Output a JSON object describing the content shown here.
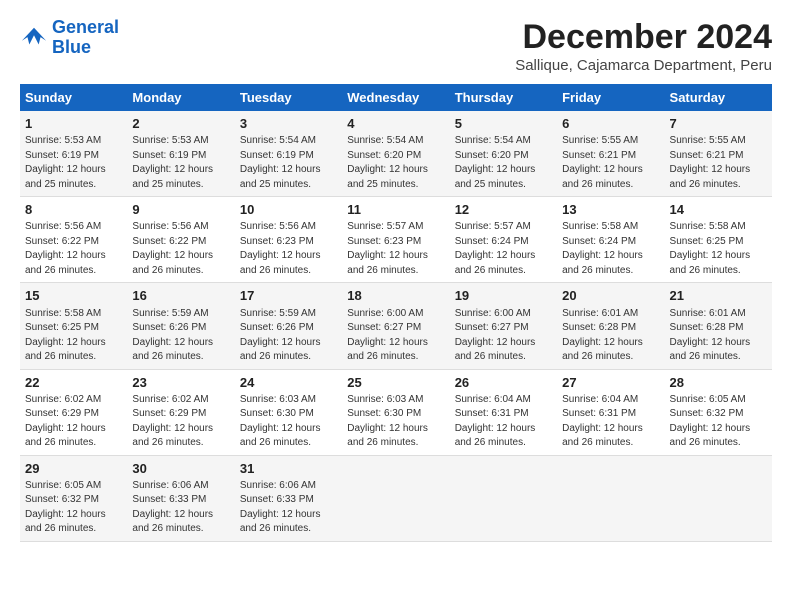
{
  "logo": {
    "line1": "General",
    "line2": "Blue"
  },
  "title": "December 2024",
  "subtitle": "Sallique, Cajamarca Department, Peru",
  "days_header": [
    "Sunday",
    "Monday",
    "Tuesday",
    "Wednesday",
    "Thursday",
    "Friday",
    "Saturday"
  ],
  "weeks": [
    [
      {
        "day": "1",
        "info": "Sunrise: 5:53 AM\nSunset: 6:19 PM\nDaylight: 12 hours\nand 25 minutes."
      },
      {
        "day": "2",
        "info": "Sunrise: 5:53 AM\nSunset: 6:19 PM\nDaylight: 12 hours\nand 25 minutes."
      },
      {
        "day": "3",
        "info": "Sunrise: 5:54 AM\nSunset: 6:19 PM\nDaylight: 12 hours\nand 25 minutes."
      },
      {
        "day": "4",
        "info": "Sunrise: 5:54 AM\nSunset: 6:20 PM\nDaylight: 12 hours\nand 25 minutes."
      },
      {
        "day": "5",
        "info": "Sunrise: 5:54 AM\nSunset: 6:20 PM\nDaylight: 12 hours\nand 25 minutes."
      },
      {
        "day": "6",
        "info": "Sunrise: 5:55 AM\nSunset: 6:21 PM\nDaylight: 12 hours\nand 26 minutes."
      },
      {
        "day": "7",
        "info": "Sunrise: 5:55 AM\nSunset: 6:21 PM\nDaylight: 12 hours\nand 26 minutes."
      }
    ],
    [
      {
        "day": "8",
        "info": "Sunrise: 5:56 AM\nSunset: 6:22 PM\nDaylight: 12 hours\nand 26 minutes."
      },
      {
        "day": "9",
        "info": "Sunrise: 5:56 AM\nSunset: 6:22 PM\nDaylight: 12 hours\nand 26 minutes."
      },
      {
        "day": "10",
        "info": "Sunrise: 5:56 AM\nSunset: 6:23 PM\nDaylight: 12 hours\nand 26 minutes."
      },
      {
        "day": "11",
        "info": "Sunrise: 5:57 AM\nSunset: 6:23 PM\nDaylight: 12 hours\nand 26 minutes."
      },
      {
        "day": "12",
        "info": "Sunrise: 5:57 AM\nSunset: 6:24 PM\nDaylight: 12 hours\nand 26 minutes."
      },
      {
        "day": "13",
        "info": "Sunrise: 5:58 AM\nSunset: 6:24 PM\nDaylight: 12 hours\nand 26 minutes."
      },
      {
        "day": "14",
        "info": "Sunrise: 5:58 AM\nSunset: 6:25 PM\nDaylight: 12 hours\nand 26 minutes."
      }
    ],
    [
      {
        "day": "15",
        "info": "Sunrise: 5:58 AM\nSunset: 6:25 PM\nDaylight: 12 hours\nand 26 minutes."
      },
      {
        "day": "16",
        "info": "Sunrise: 5:59 AM\nSunset: 6:26 PM\nDaylight: 12 hours\nand 26 minutes."
      },
      {
        "day": "17",
        "info": "Sunrise: 5:59 AM\nSunset: 6:26 PM\nDaylight: 12 hours\nand 26 minutes."
      },
      {
        "day": "18",
        "info": "Sunrise: 6:00 AM\nSunset: 6:27 PM\nDaylight: 12 hours\nand 26 minutes."
      },
      {
        "day": "19",
        "info": "Sunrise: 6:00 AM\nSunset: 6:27 PM\nDaylight: 12 hours\nand 26 minutes."
      },
      {
        "day": "20",
        "info": "Sunrise: 6:01 AM\nSunset: 6:28 PM\nDaylight: 12 hours\nand 26 minutes."
      },
      {
        "day": "21",
        "info": "Sunrise: 6:01 AM\nSunset: 6:28 PM\nDaylight: 12 hours\nand 26 minutes."
      }
    ],
    [
      {
        "day": "22",
        "info": "Sunrise: 6:02 AM\nSunset: 6:29 PM\nDaylight: 12 hours\nand 26 minutes."
      },
      {
        "day": "23",
        "info": "Sunrise: 6:02 AM\nSunset: 6:29 PM\nDaylight: 12 hours\nand 26 minutes."
      },
      {
        "day": "24",
        "info": "Sunrise: 6:03 AM\nSunset: 6:30 PM\nDaylight: 12 hours\nand 26 minutes."
      },
      {
        "day": "25",
        "info": "Sunrise: 6:03 AM\nSunset: 6:30 PM\nDaylight: 12 hours\nand 26 minutes."
      },
      {
        "day": "26",
        "info": "Sunrise: 6:04 AM\nSunset: 6:31 PM\nDaylight: 12 hours\nand 26 minutes."
      },
      {
        "day": "27",
        "info": "Sunrise: 6:04 AM\nSunset: 6:31 PM\nDaylight: 12 hours\nand 26 minutes."
      },
      {
        "day": "28",
        "info": "Sunrise: 6:05 AM\nSunset: 6:32 PM\nDaylight: 12 hours\nand 26 minutes."
      }
    ],
    [
      {
        "day": "29",
        "info": "Sunrise: 6:05 AM\nSunset: 6:32 PM\nDaylight: 12 hours\nand 26 minutes."
      },
      {
        "day": "30",
        "info": "Sunrise: 6:06 AM\nSunset: 6:33 PM\nDaylight: 12 hours\nand 26 minutes."
      },
      {
        "day": "31",
        "info": "Sunrise: 6:06 AM\nSunset: 6:33 PM\nDaylight: 12 hours\nand 26 minutes."
      },
      {
        "day": "",
        "info": ""
      },
      {
        "day": "",
        "info": ""
      },
      {
        "day": "",
        "info": ""
      },
      {
        "day": "",
        "info": ""
      }
    ]
  ]
}
